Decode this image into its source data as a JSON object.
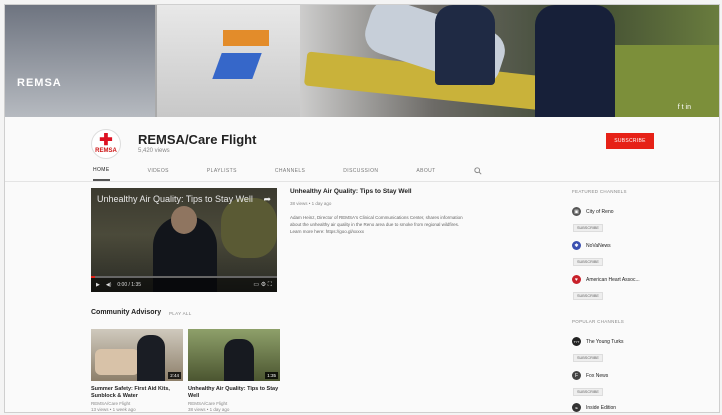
{
  "banner": {
    "vehicle_text": "REMSA",
    "social_text": "f  t  in"
  },
  "channel": {
    "name": "REMSA/Care Flight",
    "subscribers": "5,420 views",
    "logo_text": "REMSA",
    "subscribe_label": "SUBSCRIBE"
  },
  "tabs": [
    {
      "label": "Home",
      "active": true
    },
    {
      "label": "Videos",
      "active": false
    },
    {
      "label": "Playlists",
      "active": false
    },
    {
      "label": "Channels",
      "active": false
    },
    {
      "label": "Discussion",
      "active": false
    },
    {
      "label": "About",
      "active": false
    }
  ],
  "featured_video": {
    "overlay_title": "Unhealthy Air Quality: Tips to Stay Well",
    "time": "0:00 / 1:35",
    "progress": 0.02,
    "title": "Unhealthy Air Quality: Tips to Stay Well",
    "meta": "38 views • 1 day ago",
    "description": "Adam Heinz, Director of REMSA's Clinical Communications Center, shares information about the unhealthy air quality in the Reno area due to smoke from regional wildfires. Learn more here: https://goo.gl/xxxxx"
  },
  "community": {
    "title": "Community Advisory",
    "play_all": "PLAY ALL",
    "cards": [
      {
        "title": "Summer Safety: First Aid Kits, Sunblock & Water",
        "duration": "2:44",
        "channel": "REMSA/Care Flight",
        "meta": "13 views • 1 week ago"
      },
      {
        "title": "Unhealthy Air Quality: Tips to Stay Well",
        "duration": "1:35",
        "channel": "REMSA/Care Flight",
        "meta": "38 views • 1 day ago"
      }
    ]
  },
  "sidebar": {
    "featured_heading": "Featured Channels",
    "featured": [
      {
        "name": "City of Reno",
        "sub": "SUBSCRIBE",
        "color": "#555555",
        "glyph": "▣"
      },
      {
        "name": "NoVaNews",
        "sub": "SUBSCRIBE",
        "color": "#3a4fb0",
        "glyph": "✱"
      },
      {
        "name": "American Heart Assoc...",
        "sub": "SUBSCRIBE",
        "color": "#c8202a",
        "glyph": "♥"
      }
    ],
    "popular_heading": "Popular Channels",
    "popular": [
      {
        "name": "The Young Turks",
        "sub": "SUBSCRIBE",
        "color": "#222222",
        "glyph": "TYT"
      },
      {
        "name": "Fox News",
        "sub": "SUBSCRIBE",
        "color": "#444444",
        "glyph": "F"
      },
      {
        "name": "Inside Edition",
        "sub": "",
        "color": "#333333",
        "glyph": "IE"
      }
    ]
  }
}
